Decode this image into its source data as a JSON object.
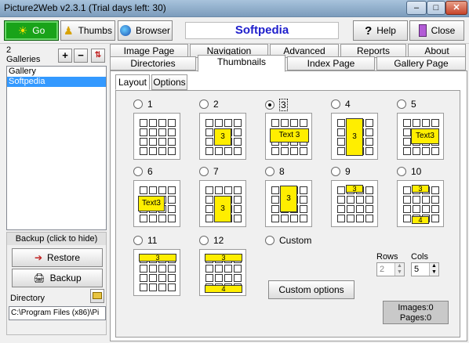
{
  "window": {
    "title": "Picture2Web v2.3.1 (Trial days left: 30)"
  },
  "toolbar": {
    "go_label": "Go",
    "thumbs_label": "Thumbs",
    "browser_label": "Browser",
    "brand_text": "Softpedia",
    "help_label": "Help",
    "close_label": "Close"
  },
  "galleries": {
    "count_line1": "2",
    "count_line2": "Galleries",
    "items": [
      "Gallery",
      "Softpedia"
    ],
    "selected": "Softpedia"
  },
  "backup": {
    "header": "Backup (click to hide)",
    "restore_label": "Restore",
    "backup_label": "Backup",
    "directory_label": "Directory",
    "directory_value": "C:\\Program Files (x86)\\Pi"
  },
  "tabs": {
    "row1": [
      "Image Page",
      "Navigation",
      "Advanced",
      "Reports",
      "About"
    ],
    "row2": [
      "Directories",
      "Thumbnails",
      "Index Page",
      "Gallery Page"
    ],
    "active": "Thumbnails"
  },
  "subtabs": {
    "items": [
      "Layout",
      "Options"
    ],
    "active": "Layout"
  },
  "layouts": {
    "selected": "3",
    "options": [
      "1",
      "2",
      "3",
      "4",
      "5",
      "6",
      "7",
      "8",
      "9",
      "10",
      "11",
      "12",
      "Custom"
    ],
    "thumb_texts": {
      "t2": "3",
      "t3": "Text 3",
      "t4": "3",
      "t5": "Text3",
      "t6": "Text3",
      "t7": "3",
      "t8": "3",
      "t9": "3",
      "t10a": "3",
      "t10b": "4",
      "t11": "3",
      "t12a": "3",
      "t12b": "4"
    }
  },
  "custom_options_label": "Custom options",
  "rows": {
    "label": "Rows",
    "value": "2"
  },
  "cols": {
    "label": "Cols",
    "value": "5"
  },
  "info": {
    "images": "Images:0",
    "pages": "Pages:0"
  }
}
